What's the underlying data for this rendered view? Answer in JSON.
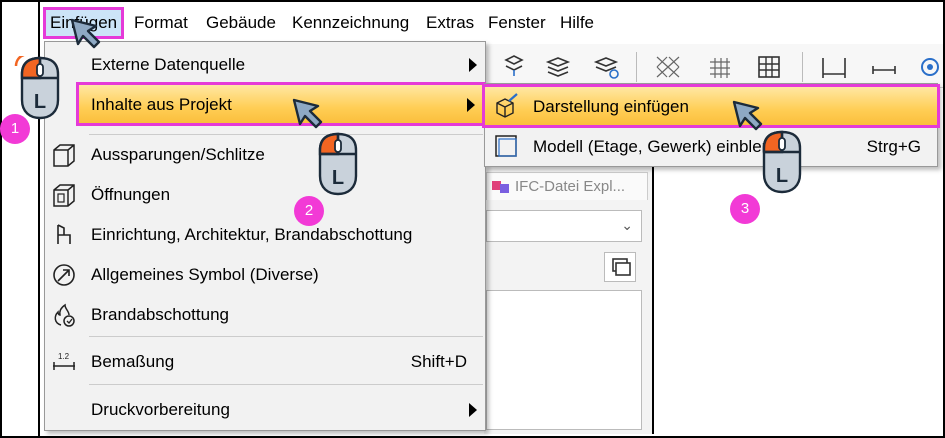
{
  "menubar": {
    "items": [
      "Einfügen",
      "Format",
      "Gebäude",
      "Kennzeichnung",
      "Extras",
      "Fenster",
      "Hilfe"
    ]
  },
  "dropdown": {
    "items": [
      {
        "label": "Externe Datenquelle",
        "submenu": true,
        "icon": "none"
      },
      {
        "label": "Inhalte aus Projekt",
        "submenu": true,
        "icon": "none",
        "highlighted": true
      },
      {
        "label": "Aussparungen/Schlitze",
        "icon": "wall-opening-icon"
      },
      {
        "label": "Öffnungen",
        "icon": "opening-icon"
      },
      {
        "label": "Einrichtung, Architektur, Brandabschottung",
        "icon": "chair-icon"
      },
      {
        "label": "Allgemeines Symbol (Diverse)",
        "icon": "symbol-icon"
      },
      {
        "label": "Brandabschottung",
        "icon": "fire-icon"
      },
      {
        "label": "Bemaßung",
        "shortcut": "Shift+D",
        "icon": "dimension-icon"
      },
      {
        "label": "Druckvorbereitung",
        "submenu": true,
        "icon": "none"
      }
    ]
  },
  "submenu": {
    "items": [
      {
        "label": "Darstellung einfügen",
        "icon": "insert-view-icon",
        "highlighted": true
      },
      {
        "label": "Modell (Etage, Gewerk) einblenden",
        "shortcut": "Strg+G",
        "icon": "model-icon"
      }
    ]
  },
  "panel": {
    "tab_label": "IFC-Datei Expl..."
  },
  "annotations": {
    "badges": [
      "1",
      "2",
      "3"
    ],
    "mouse_label": "L"
  },
  "colors": {
    "highlight_outline": "#e53ad8",
    "highlight_fill": "#ffce55",
    "badge": "#f23ad6",
    "mouse_button": "#f26522"
  }
}
